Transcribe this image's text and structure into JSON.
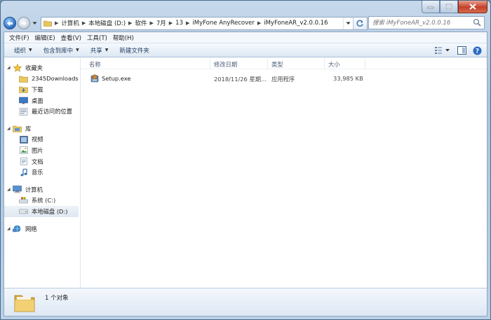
{
  "address": {
    "crumbs": [
      "计算机",
      "本地磁盘 (D:)",
      "软件",
      "7月",
      "13",
      "iMyFone AnyRecover",
      "iMyFoneAR_v2.0.0.16"
    ]
  },
  "search": {
    "placeholder": "搜索 iMyFoneAR_v2.0.0.16"
  },
  "menu": [
    "文件(F)",
    "编辑(E)",
    "查看(V)",
    "工具(T)",
    "帮助(H)"
  ],
  "toolbar": {
    "organize": "组织",
    "include_in_library": "包含到库中",
    "share": "共享",
    "new_folder": "新建文件夹"
  },
  "nav": {
    "favorites": {
      "label": "收藏夹",
      "items": [
        "2345Downloads",
        "下载",
        "桌面",
        "最近访问的位置"
      ]
    },
    "libraries": {
      "label": "库",
      "items": [
        "视频",
        "图片",
        "文档",
        "音乐"
      ]
    },
    "computer": {
      "label": "计算机",
      "items": [
        "系统 (C:)",
        "本地磁盘 (D:)"
      ]
    },
    "network": {
      "label": "网络"
    }
  },
  "columns": {
    "name": "名称",
    "modified": "修改日期",
    "type": "类型",
    "size": "大小"
  },
  "files": [
    {
      "name": "Setup.exe",
      "modified": "2018/11/26 星期...",
      "type": "应用程序",
      "size": "33,985 KB"
    }
  ],
  "details": {
    "count": "1 个对象"
  },
  "colors": {
    "frame": "#aac4de",
    "selection": "#dfe7f1",
    "toolbar_text": "#1e3b5e"
  }
}
